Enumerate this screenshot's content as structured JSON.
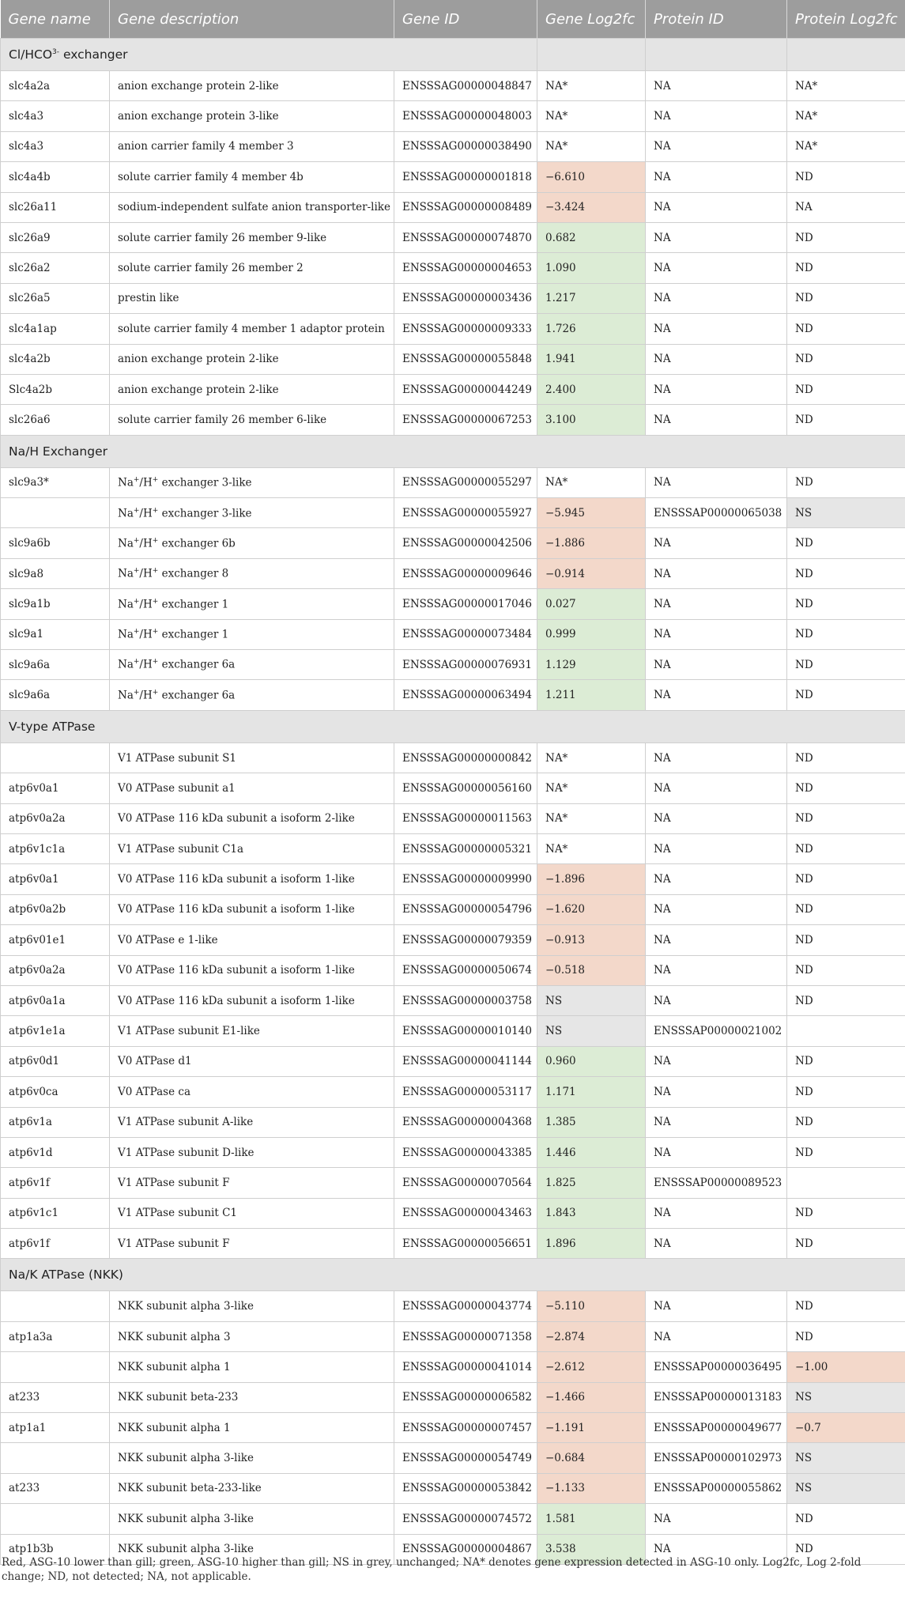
{
  "headers": [
    "Gene name",
    "Gene description",
    "Gene ID",
    "Gene Log2fc",
    "Protein ID",
    "Protein Log2fc"
  ],
  "sections": [
    {
      "title": "Cl/HCO3- exchanger",
      "rows": [
        [
          "slc4a2a",
          "anion exchange protein 2-like",
          "ENSSSAG00000048847",
          "NA*",
          "NA",
          "NA*"
        ],
        [
          "slc4a3",
          "anion exchange protein 3-like",
          "ENSSSAG00000048003",
          "NA*",
          "NA",
          "NA*"
        ],
        [
          "slc4a3",
          "anion carrier family 4 member 3",
          "ENSSSAG00000038490",
          "NA*",
          "NA",
          "NA*"
        ],
        [
          "slc4a4b",
          "solute carrier family 4 member 4b",
          "ENSSSAG00000001818",
          "−6.610",
          "NA",
          "ND"
        ],
        [
          "slc26a11",
          "sodium-independent sulfate anion transporter-like",
          "ENSSSAG00000008489",
          "−3.424",
          "NA",
          "NA"
        ],
        [
          "slc26a9",
          "solute carrier family 26 member 9-like",
          "ENSSSAG00000074870",
          "0.682",
          "NA",
          "ND"
        ],
        [
          "slc26a2",
          "solute carrier family 26 member 2",
          "ENSSSAG00000004653",
          "1.090",
          "NA",
          "ND"
        ],
        [
          "slc26a5",
          "prestin like",
          "ENSSSAG00000003436",
          "1.217",
          "NA",
          "ND"
        ],
        [
          "slc4a1ap",
          "solute carrier family 4 member 1 adaptor protein",
          "ENSSSAG00000009333",
          "1.726",
          "NA",
          "ND"
        ],
        [
          "slc4a2b",
          "anion exchange protein 2-like",
          "ENSSSAG00000055848",
          "1.941",
          "NA",
          "ND"
        ],
        [
          "Slc4a2b",
          "anion exchange protein 2-like",
          "ENSSSAG00000044249",
          "2.400",
          "NA",
          "ND"
        ],
        [
          "slc26a6",
          "solute carrier family 26 member 6-like",
          "ENSSSAG00000067253",
          "3.100",
          "NA",
          "ND"
        ]
      ]
    },
    {
      "title": "Na/H Exchanger",
      "rows": [
        [
          "slc9a3*",
          "Na+/H+ exchanger 3-like",
          "ENSSSAG00000055297",
          "NA*",
          "NA",
          "ND"
        ],
        [
          "",
          "Na+/H+ exchanger 3-like",
          "ENSSSAG00000055927",
          "−5.945",
          "ENSSSAP00000065038",
          "NS"
        ],
        [
          "slc9a6b",
          "Na+/H+ exchanger 6b",
          "ENSSSAG00000042506",
          "−1.886",
          "NA",
          "ND"
        ],
        [
          "slc9a8",
          "Na+/H+ exchanger 8",
          "ENSSSAG00000009646",
          "−0.914",
          "NA",
          "ND"
        ],
        [
          "slc9a1b",
          "Na+/H+ exchanger 1",
          "ENSSSAG00000017046",
          "0.027",
          "NA",
          "ND"
        ],
        [
          "slc9a1",
          "Na+/H+ exchanger 1",
          "ENSSSAG00000073484",
          "0.999",
          "NA",
          "ND"
        ],
        [
          "slc9a6a",
          "Na+/H+ exchanger 6a",
          "ENSSSAG00000076931",
          "1.129",
          "NA",
          "ND"
        ],
        [
          "slc9a6a",
          "Na+/H+ exchanger 6a",
          "ENSSSAG00000063494",
          "1.211",
          "NA",
          "ND"
        ]
      ]
    },
    {
      "title": "V-type ATPase",
      "rows": [
        [
          "",
          "V1 ATPase subunit S1",
          "ENSSSAG00000000842",
          "NA*",
          "NA",
          "ND"
        ],
        [
          "atp6v0a1",
          "V0 ATPase subunit a1",
          "ENSSSAG00000056160",
          "NA*",
          "NA",
          "ND"
        ],
        [
          "atp6v0a2a",
          "V0 ATPase 116 kDa subunit a isoform 2-like",
          "ENSSSAG00000011563",
          "NA*",
          "NA",
          "ND"
        ],
        [
          "atp6v1c1a",
          "V1 ATPase subunit C1a",
          "ENSSSAG00000005321",
          "NA*",
          "NA",
          "ND"
        ],
        [
          "atp6v0a1",
          "V0 ATPase 116 kDa subunit a isoform 1-like",
          "ENSSSAG00000009990",
          "−1.896",
          "NA",
          "ND"
        ],
        [
          "atp6v0a2b",
          "V0 ATPase 116 kDa subunit a isoform 1-like",
          "ENSSSAG00000054796",
          "−1.620",
          "NA",
          "ND"
        ],
        [
          "atp6v01e1",
          "V0 ATPase e 1-like",
          "ENSSSAG00000079359",
          "−0.913",
          "NA",
          "ND"
        ],
        [
          "atp6v0a2a",
          "V0 ATPase 116 kDa subunit a isoform 1-like",
          "ENSSSAG00000050674",
          "−0.518",
          "NA",
          "ND"
        ],
        [
          "atp6v0a1a",
          "V0 ATPase 116 kDa subunit a isoform 1-like",
          "ENSSSAG00000003758",
          "NS",
          "NA",
          "ND"
        ],
        [
          "atp6v1e1a",
          "V1 ATPase subunit E1-like",
          "ENSSSAG00000010140",
          "NS",
          "ENSSSAP00000021002",
          ""
        ],
        [
          "atp6v0d1",
          "V0 ATPase d1",
          "ENSSSAG00000041144",
          "0.960",
          "NA",
          "ND"
        ],
        [
          "atp6v0ca",
          "V0 ATPase ca",
          "ENSSSAG00000053117",
          "1.171",
          "NA",
          "ND"
        ],
        [
          "atp6v1a",
          "V1 ATPase subunit A-like",
          "ENSSSAG00000004368",
          "1.385",
          "NA",
          "ND"
        ],
        [
          "atp6v1d",
          "V1 ATPase subunit D-like",
          "ENSSSAG00000043385",
          "1.446",
          "NA",
          "ND"
        ],
        [
          "atp6v1f",
          "V1 ATPase subunit F",
          "ENSSSAG00000070564",
          "1.825",
          "ENSSSAP00000089523",
          ""
        ],
        [
          "atp6v1c1",
          "V1 ATPase subunit C1",
          "ENSSSAG00000043463",
          "1.843",
          "NA",
          "ND"
        ],
        [
          "atp6v1f",
          "V1 ATPase subunit F",
          "ENSSSAG00000056651",
          "1.896",
          "NA",
          "ND"
        ]
      ]
    },
    {
      "title": "Na/K ATPase (NKK)",
      "rows": [
        [
          "",
          "NKK subunit alpha 3-like",
          "ENSSSAG00000043774",
          "−5.110",
          "NA",
          "ND"
        ],
        [
          "atp1a3a",
          "NKK subunit alpha 3",
          "ENSSSAG00000071358",
          "−2.874",
          "NA",
          "ND"
        ],
        [
          "",
          "NKK subunit alpha 1",
          "ENSSSAG00000041014",
          "−2.612",
          "ENSSSAP00000036495",
          "−1.00"
        ],
        [
          "at233",
          "NKK subunit beta-233",
          "ENSSSAG00000006582",
          "−1.466",
          "ENSSSAP00000013183",
          "NS"
        ],
        [
          "atp1a1",
          "NKK subunit alpha 1",
          "ENSSSAG00000007457",
          "−1.191",
          "ENSSSAP00000049677",
          "−0.7"
        ],
        [
          "",
          "NKK subunit alpha 3-like",
          "ENSSSAG00000054749",
          "−0.684",
          "ENSSSAP00000102973",
          "NS"
        ],
        [
          "at233",
          "NKK subunit beta-233-like",
          "ENSSSAG00000053842",
          "−1.133",
          "ENSSSAP00000055862",
          "NS"
        ],
        [
          "",
          "NKK subunit alpha 3-like",
          "ENSSSAG00000074572",
          "1.581",
          "NA",
          "ND"
        ],
        [
          "atp1b3b",
          "NKK subunit alpha 3-like",
          "ENSSSAG00000004867",
          "3.538",
          "NA",
          "ND"
        ]
      ]
    }
  ],
  "footnote": "Red, ASG-10 lower than gill; green, ASG-10 higher than gill; NS in grey, unchanged; NA* denotes gene expression detected in ASG-10 only. Log2fc, Log 2-fold change; ND, not detected; NA, not applicable.",
  "colors": {
    "header_bg": "#9d9d9d",
    "section_bg": "#e4e4e4",
    "lower": "#f3d8ca",
    "higher": "#dcecd5",
    "unchanged": "#e6e6e6"
  }
}
